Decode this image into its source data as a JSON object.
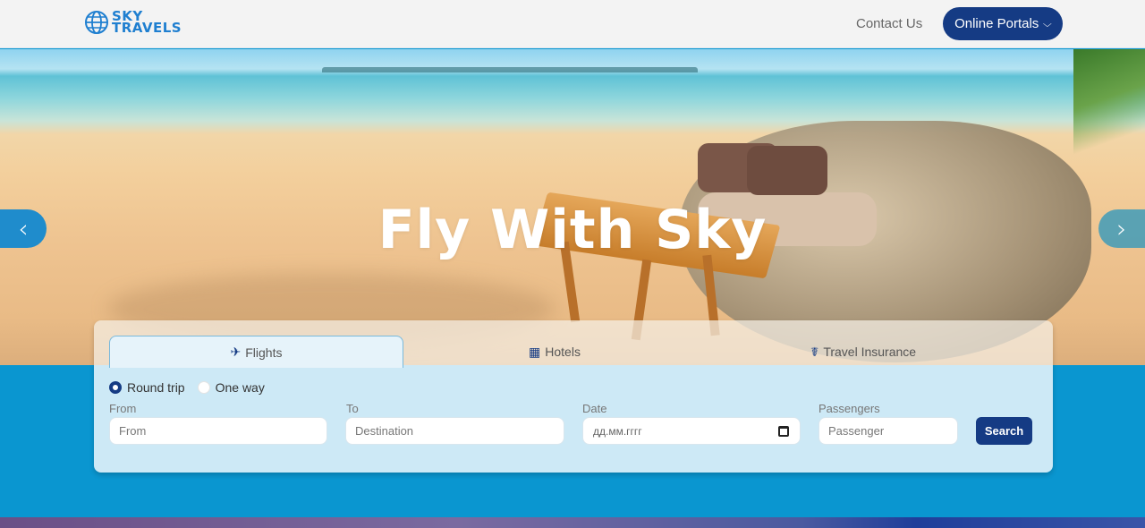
{
  "navbar": {
    "logo": {
      "line1": "SKY",
      "line2": "TRAVELS"
    },
    "contact_label": "Contact Us",
    "portals_label": "Online Portals",
    "portals_icon": "chevron-down-icon"
  },
  "hero": {
    "title": "Fly With Sky",
    "prev_label": "‹",
    "next_label": "›"
  },
  "search_panel": {
    "tabs": [
      {
        "label": "Flights",
        "icon": "plane-icon",
        "active": true
      },
      {
        "label": "Hotels",
        "icon": "building-icon",
        "active": false
      },
      {
        "label": "Travel Insurance",
        "icon": "medical-briefcase-icon",
        "active": false
      }
    ],
    "trip_types": [
      {
        "label": "Round trip",
        "selected": true
      },
      {
        "label": "One way",
        "selected": false
      }
    ],
    "fields": {
      "from": {
        "label": "From",
        "placeholder": "From",
        "value": ""
      },
      "to": {
        "label": "To",
        "placeholder": "Destination",
        "value": ""
      },
      "date": {
        "label": "Date",
        "placeholder": "дд.мм.гггг",
        "value": ""
      },
      "passengers": {
        "label": "Passengers",
        "placeholder": "Passenger",
        "value": ""
      }
    },
    "search_label": "Search"
  },
  "colors": {
    "brand_navy": "#153b84",
    "brand_blue": "#1f7fd0",
    "band_blue": "#0a96d0",
    "panel_bg": "#cde9f6"
  }
}
